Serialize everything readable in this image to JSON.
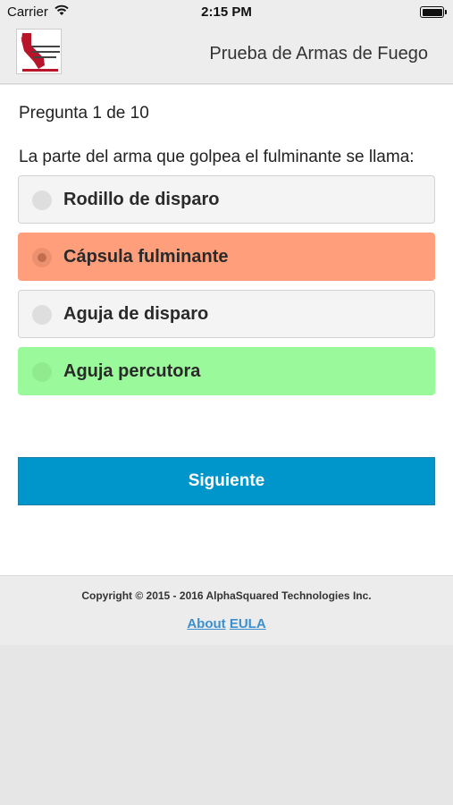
{
  "status_bar": {
    "carrier": "Carrier",
    "time": "2:15 PM",
    "battery_icon": "battery-full-icon",
    "wifi_icon": "wifi-icon"
  },
  "header": {
    "logo_text": "PRUEBA DE ARMAS DE FUEGO DE CALIFORNIA",
    "title": "Prueba de Armas de Fuego"
  },
  "quiz": {
    "counter": "Pregunta 1 de 10",
    "question": "La parte del arma que golpea el fulminante se llama:",
    "options": [
      {
        "label": "Rodillo de disparo",
        "state": "default",
        "color": "#f4f4f4"
      },
      {
        "label": "Cápsula fulminante",
        "state": "selected-wrong",
        "color": "#ff9e7a"
      },
      {
        "label": "Aguja de disparo",
        "state": "default",
        "color": "#f4f4f4"
      },
      {
        "label": "Aguja percutora",
        "state": "correct",
        "color": "#9af99a"
      }
    ],
    "next_label": "Siguiente",
    "next_color": "#0095cb"
  },
  "footer": {
    "copyright": "Copyright © 2015 - 2016 AlphaSquared Technologies Inc.",
    "about_label": "About",
    "eula_label": "EULA"
  }
}
